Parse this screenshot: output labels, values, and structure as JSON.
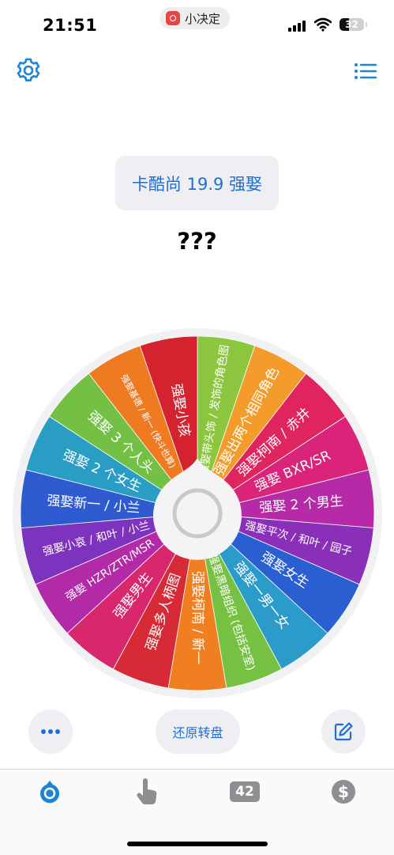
{
  "status": {
    "time": "21:51",
    "app_name": "小决定",
    "battery": "32"
  },
  "header": {
    "settings_icon": "gear-icon",
    "list_icon": "list-icon"
  },
  "title": "卡酷尚 19.9 强娶",
  "result": "???",
  "wheel": {
    "items": [
      {
        "label": "强娶带头饰 / 发饰的角色图",
        "color": "#8cc63f"
      },
      {
        "label": "强娶出两个相同角色",
        "color": "#f39c2b"
      },
      {
        "label": "强娶柯南 / 赤井",
        "color": "#e0245e"
      },
      {
        "label": "强娶 BXR/SR",
        "color": "#d9247a"
      },
      {
        "label": "强娶 2 个男生",
        "color": "#b62aa8"
      },
      {
        "label": "强娶平次 / 和叶 / 园子",
        "color": "#8a2fb8"
      },
      {
        "label": "强娶女生",
        "color": "#2a5fd1"
      },
      {
        "label": "强娶一男一女",
        "color": "#2b9bc9"
      },
      {
        "label": "强娶黑暗组织 (包括安室)",
        "color": "#76c043"
      },
      {
        "label": "强娶柯南 / 新一",
        "color": "#f07f22"
      },
      {
        "label": "强娶多人柄图",
        "color": "#d62a36"
      },
      {
        "label": "强娶男生",
        "color": "#d8276c"
      },
      {
        "label": "强娶 HZR/ZTR/MSR",
        "color": "#b22aa6"
      },
      {
        "label": "强娶小哀 / 和叶 / 小兰",
        "color": "#7d33bd"
      },
      {
        "label": "强娶新一 / 小兰",
        "color": "#2e5bd0"
      },
      {
        "label": "强娶 2 个女生",
        "color": "#2a9dc5"
      },
      {
        "label": "强娶 3 个人头",
        "color": "#73c045"
      },
      {
        "label": "强娶基德 / 新一 (快斗也算)",
        "color": "#ee7b22"
      },
      {
        "label": "强娶小孩",
        "color": "#d4232f"
      }
    ]
  },
  "bottom": {
    "more_icon": "ellipsis-icon",
    "restore_label": "还原转盘",
    "edit_icon": "edit-icon"
  },
  "tabbar": {
    "count_badge": "42",
    "tabs": [
      "wheel-icon",
      "hand-pointer-icon",
      "count-icon",
      "dollar-icon"
    ]
  }
}
